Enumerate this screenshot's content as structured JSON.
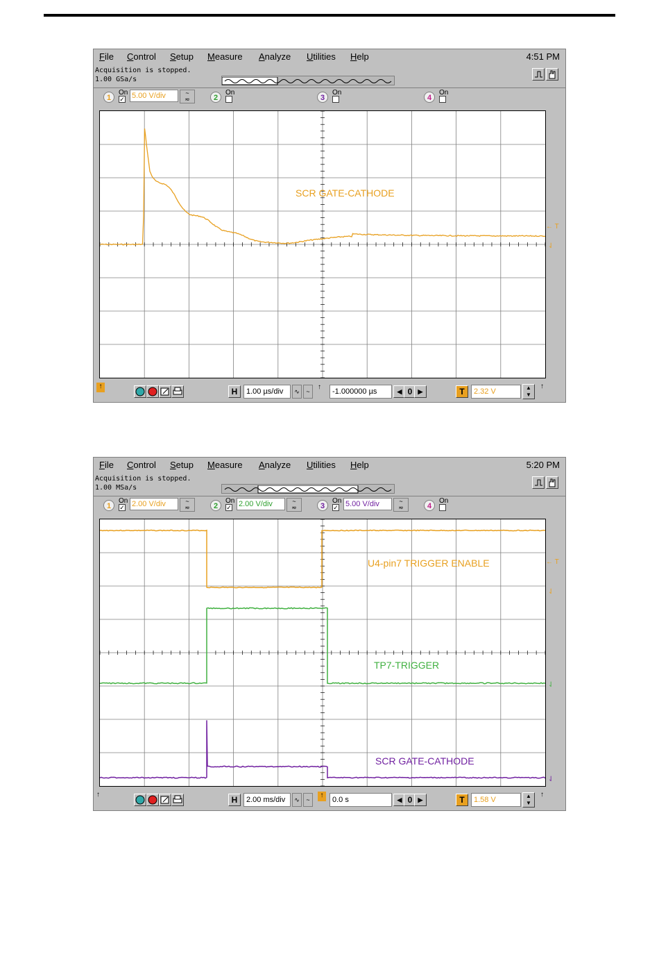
{
  "scope1": {
    "menu": [
      "File",
      "Control",
      "Setup",
      "Measure",
      "Analyze",
      "Utilities",
      "Help"
    ],
    "clock": "4:51 PM",
    "status_line1": "Acquisition is stopped.",
    "status_line2": "1.00 GSa/s",
    "channels": [
      {
        "num": "1",
        "on_label": "On",
        "checked": true,
        "vdiv": "5.00 V/div",
        "color": "#e8a020"
      },
      {
        "num": "2",
        "on_label": "On",
        "checked": false,
        "vdiv": "",
        "color": "#30a030"
      },
      {
        "num": "3",
        "on_label": "On",
        "checked": false,
        "vdiv": "",
        "color": "#7020a0"
      },
      {
        "num": "4",
        "on_label": "On",
        "checked": false,
        "vdiv": "",
        "color": "#c0208a"
      }
    ],
    "timebase": "1.00 µs/div",
    "delay": "-1.000000 µs",
    "delay_ctrl": "0",
    "trigger_level": "2.32 V",
    "trace_labels": [
      "SCR GATE-CATHODE"
    ],
    "markers": {
      "t": "← T"
    }
  },
  "scope2": {
    "menu": [
      "File",
      "Control",
      "Setup",
      "Measure",
      "Analyze",
      "Utilities",
      "Help"
    ],
    "clock": "5:20 PM",
    "status_line1": "Acquisition is stopped.",
    "status_line2": "1.00 MSa/s",
    "channels": [
      {
        "num": "1",
        "on_label": "On",
        "checked": true,
        "vdiv": "2.00 V/div",
        "color": "#e8a020"
      },
      {
        "num": "2",
        "on_label": "On",
        "checked": true,
        "vdiv": "2.00 V/div",
        "color": "#30a030"
      },
      {
        "num": "3",
        "on_label": "On",
        "checked": true,
        "vdiv": "5.00 V/div",
        "color": "#7020a0"
      },
      {
        "num": "4",
        "on_label": "On",
        "checked": false,
        "vdiv": "",
        "color": "#c0208a"
      }
    ],
    "timebase": "2.00 ms/div",
    "delay": "0.0 s",
    "delay_ctrl": "0",
    "trigger_level": "1.58 V",
    "trace_labels": [
      "U4-pin7 TRIGGER ENABLE",
      "TP7-TRIGGER",
      "SCR GATE-CATHODE"
    ],
    "markers": {
      "t": "← T"
    }
  }
}
